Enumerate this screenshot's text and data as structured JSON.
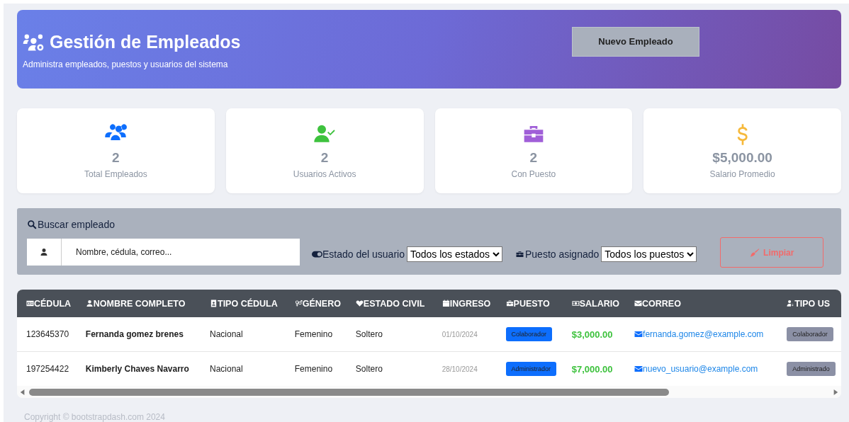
{
  "header": {
    "title": "Gestión de Empleados",
    "subtitle": "Administra empleados, puestos y usuarios del sistema",
    "button": "Nuevo Empleado"
  },
  "stats": [
    {
      "value": "2",
      "label": "Total Empleados"
    },
    {
      "value": "2",
      "label": "Usuarios Activos"
    },
    {
      "value": "2",
      "label": "Con Puesto"
    },
    {
      "value": "$5,000.00",
      "label": "Salario Promedio"
    }
  ],
  "filters": {
    "search_label": "Buscar empleado",
    "search": {
      "placeholder": "Nombre, cédula, correo..."
    },
    "status_label": "Estado del usuario",
    "status_value": "Todos los estados",
    "position_label": "Puesto asignado",
    "position_value": "Todos los puestos",
    "clear_button": "Limpiar"
  },
  "table": {
    "columns": [
      "CÉDULA",
      "NOMBRE COMPLETO",
      "TIPO CÉDULA",
      "GÉNERO",
      "ESTADO CIVIL",
      "INGRESO",
      "PUESTO",
      "SALARIO",
      "CORREO",
      "TIPO US"
    ],
    "rows": [
      {
        "cedula": "123645370",
        "name": "Fernanda gomez brenes",
        "id_type": "Nacional",
        "gender": "Femenino",
        "civil": "Soltero",
        "date": "01/10/2024",
        "position": "Colaborador",
        "salary": "$3,000.00",
        "email": "fernanda.gomez@example.com",
        "user_type": "Colaborador"
      },
      {
        "cedula": "197254422",
        "name": "Kimberly Chaves Navarro",
        "id_type": "Nacional",
        "gender": "Femenino",
        "civil": "Soltero",
        "date": "28/10/2024",
        "position": "Administrador",
        "salary": "$7,000.00",
        "email": "nuevo_usuario@example.com",
        "user_type": "Administrado"
      }
    ]
  },
  "footer": "Copyright © bootstrapdash.com 2024"
}
